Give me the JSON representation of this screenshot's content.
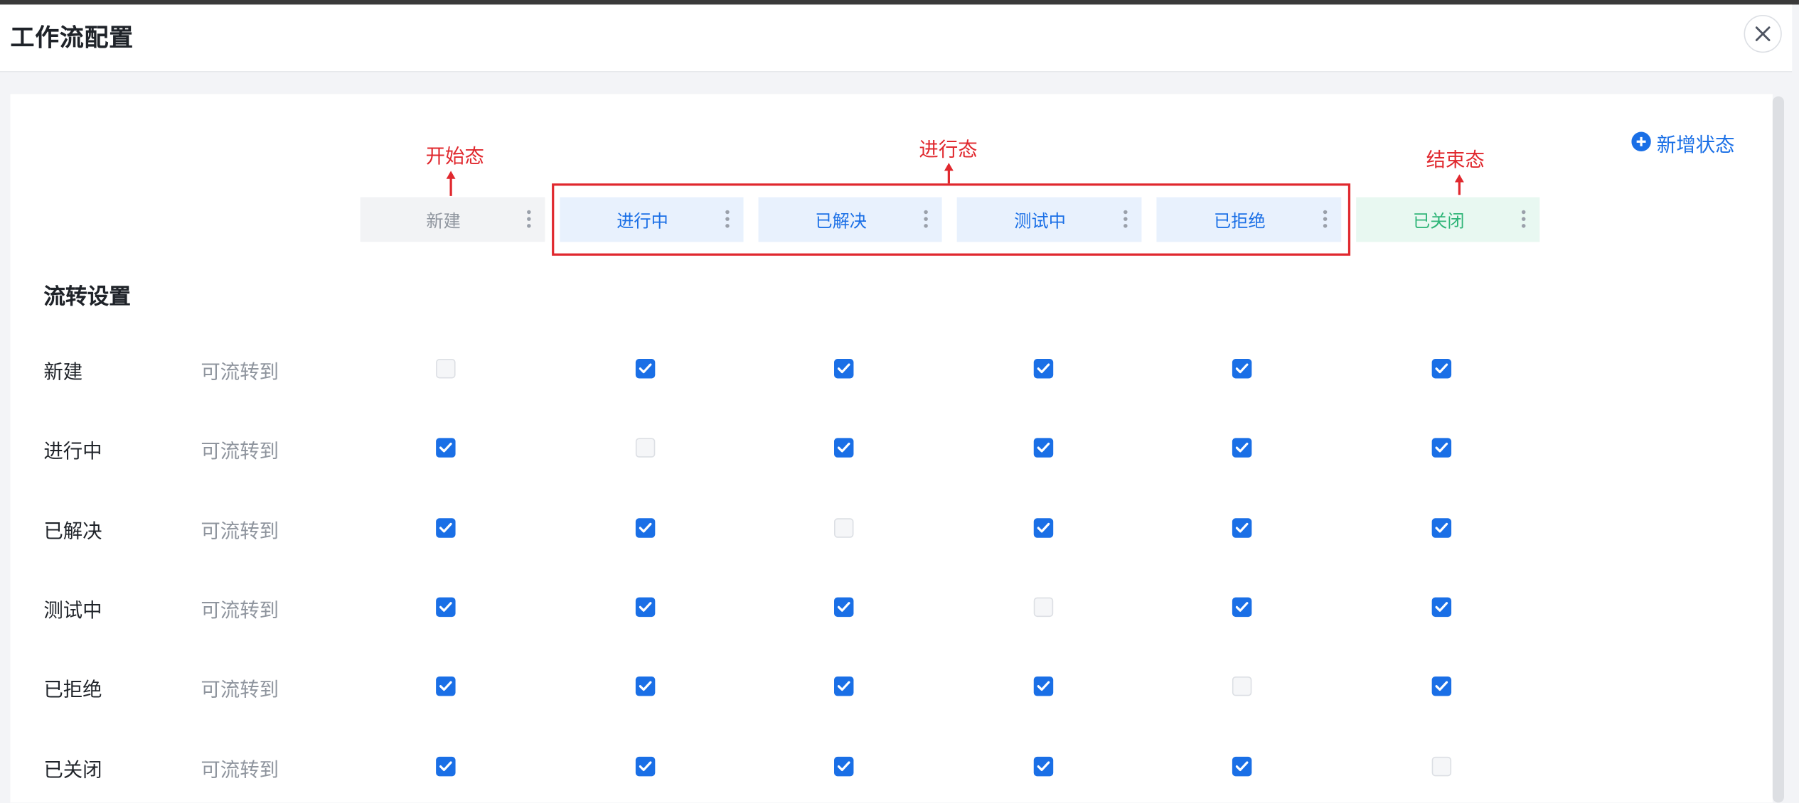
{
  "dialog": {
    "title": "工作流配置",
    "close_icon": "close-icon"
  },
  "annotations": {
    "start": "开始态",
    "progress": "进行态",
    "end": "结束态",
    "color": "#e0282e"
  },
  "add_state": {
    "label": "新增状态",
    "icon": "plus-circle-icon"
  },
  "states": [
    {
      "label": "新建",
      "kind": "start"
    },
    {
      "label": "进行中",
      "kind": "progress"
    },
    {
      "label": "已解决",
      "kind": "progress"
    },
    {
      "label": "测试中",
      "kind": "progress"
    },
    {
      "label": "已拒绝",
      "kind": "progress"
    },
    {
      "label": "已关闭",
      "kind": "end"
    }
  ],
  "transition": {
    "section_title": "流转设置",
    "hint": "可流转到",
    "rows": [
      {
        "name": "新建",
        "checks": [
          false,
          true,
          true,
          true,
          true,
          true
        ]
      },
      {
        "name": "进行中",
        "checks": [
          true,
          false,
          true,
          true,
          true,
          true
        ]
      },
      {
        "name": "已解决",
        "checks": [
          true,
          true,
          false,
          true,
          true,
          true
        ]
      },
      {
        "name": "测试中",
        "checks": [
          true,
          true,
          true,
          false,
          true,
          true
        ]
      },
      {
        "name": "已拒绝",
        "checks": [
          true,
          true,
          true,
          true,
          false,
          true
        ]
      },
      {
        "name": "已关闭",
        "checks": [
          true,
          true,
          true,
          true,
          true,
          false
        ]
      }
    ]
  },
  "colors": {
    "accent": "#1a6fe6",
    "start_tab_bg": "#f2f3f5",
    "progress_tab_bg": "#e8f1fd",
    "end_tab_bg": "#e8f8f1",
    "end_text": "#2fb578"
  }
}
